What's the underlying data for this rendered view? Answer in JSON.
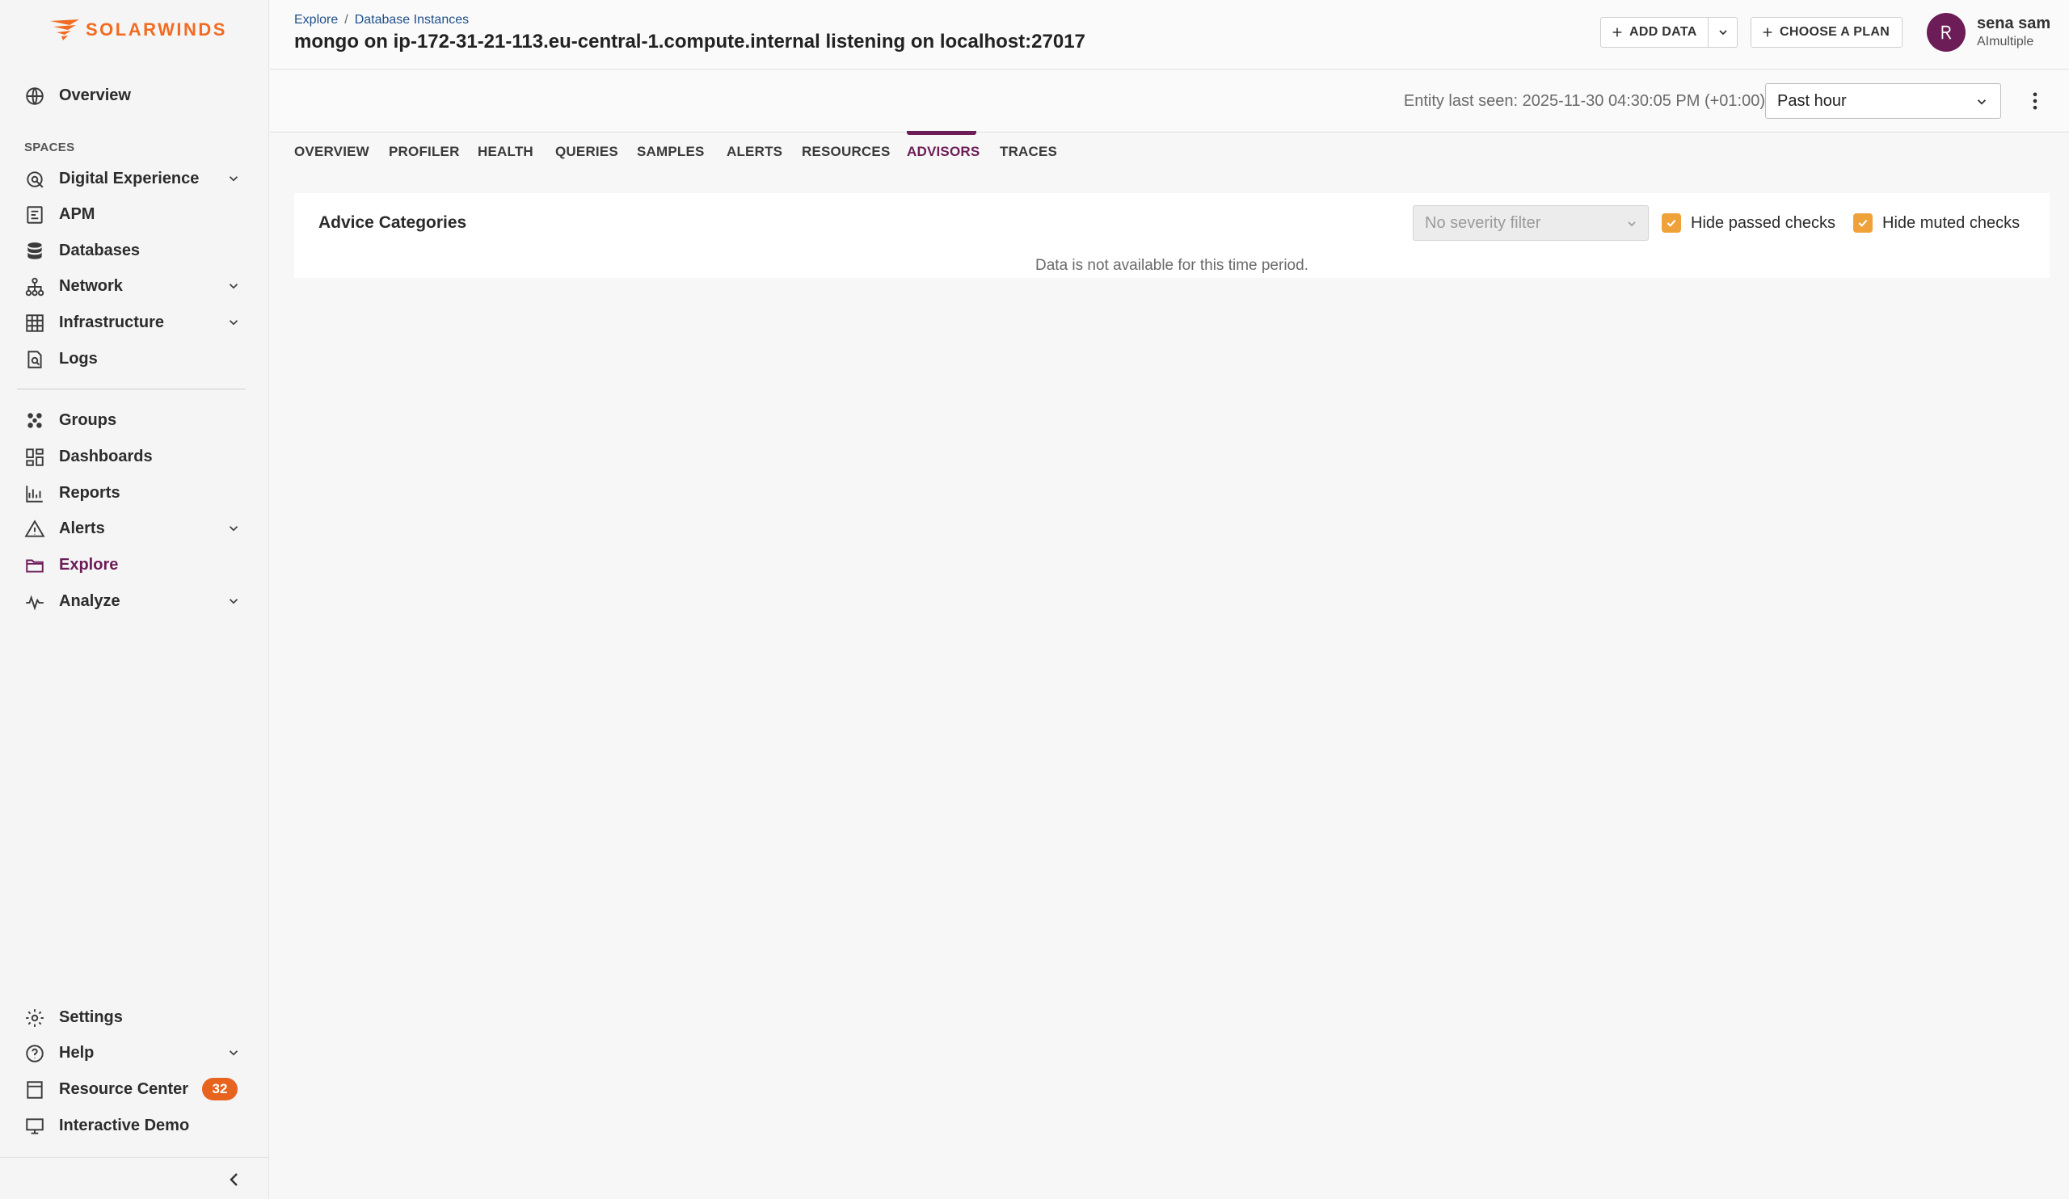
{
  "brand": {
    "name": "SOLARWINDS",
    "color": "#f26b21"
  },
  "sidebar": {
    "spaces_label": "SPACES",
    "items": [
      {
        "label": "Overview",
        "icon": "globe-icon"
      },
      {
        "label": "Digital Experience",
        "icon": "digital-experience-icon",
        "expandable": true
      },
      {
        "label": "APM",
        "icon": "apm-icon"
      },
      {
        "label": "Databases",
        "icon": "database-icon"
      },
      {
        "label": "Network",
        "icon": "network-icon",
        "expandable": true
      },
      {
        "label": "Infrastructure",
        "icon": "infrastructure-icon",
        "expandable": true
      },
      {
        "label": "Logs",
        "icon": "logs-icon"
      },
      {
        "label": "Groups",
        "icon": "groups-icon"
      },
      {
        "label": "Dashboards",
        "icon": "dashboards-icon"
      },
      {
        "label": "Reports",
        "icon": "reports-icon"
      },
      {
        "label": "Alerts",
        "icon": "alert-icon",
        "expandable": true
      },
      {
        "label": "Explore",
        "icon": "folder-icon",
        "active": true
      },
      {
        "label": "Analyze",
        "icon": "analyze-icon",
        "expandable": true
      },
      {
        "label": "Settings",
        "icon": "gear-icon"
      },
      {
        "label": "Help",
        "icon": "help-icon",
        "expandable": true
      },
      {
        "label": "Resource Center",
        "icon": "resource-center-icon",
        "badge": "32"
      },
      {
        "label": "Interactive Demo",
        "icon": "monitor-icon"
      }
    ]
  },
  "header": {
    "breadcrumb": [
      "Explore",
      "Database Instances"
    ],
    "breadcrumb_sep": "/",
    "title": "mongo on ip-172-31-21-113.eu-central-1.compute.internal listening on localhost:27017",
    "add_data_label": "ADD DATA",
    "choose_plan_label": "CHOOSE A PLAN",
    "user": {
      "name": "sena sam",
      "org": "AImultiple",
      "avatar_color": "#6c1d57"
    }
  },
  "subbar": {
    "last_seen": "Entity last seen: 2025-11-30 04:30:05 PM (+01:00)",
    "time_range": "Past hour"
  },
  "tabs": [
    {
      "label": "OVERVIEW"
    },
    {
      "label": "PROFILER"
    },
    {
      "label": "HEALTH"
    },
    {
      "label": "QUERIES"
    },
    {
      "label": "SAMPLES"
    },
    {
      "label": "ALERTS"
    },
    {
      "label": "RESOURCES"
    },
    {
      "label": "ADVISORS",
      "active": true
    },
    {
      "label": "TRACES"
    }
  ],
  "advisors": {
    "card_title": "Advice Categories",
    "severity_placeholder": "No severity filter",
    "hide_passed_label": "Hide passed checks",
    "hide_passed_checked": true,
    "hide_muted_label": "Hide muted checks",
    "hide_muted_checked": true,
    "empty_message": "Data is not available for this time period."
  },
  "colors": {
    "accent": "#6c1d57",
    "checkbox": "#f0a23a",
    "badge": "#e8641e"
  }
}
